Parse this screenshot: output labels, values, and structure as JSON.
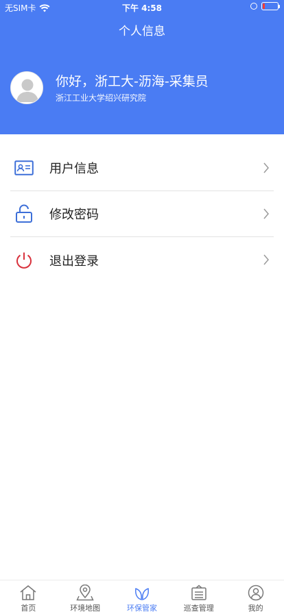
{
  "status_bar": {
    "carrier": "无SIM卡",
    "time": "下午 4:58"
  },
  "header": {
    "title": "个人信息",
    "greeting": "你好，浙工大-沥海-采集员",
    "organization": "浙江工业大学绍兴研究院",
    "color": "#4a7cf3"
  },
  "menu": {
    "items": [
      {
        "label": "用户信息",
        "icon": "id-card-icon"
      },
      {
        "label": "修改密码",
        "icon": "unlock-icon"
      },
      {
        "label": "退出登录",
        "icon": "power-icon"
      }
    ]
  },
  "tabbar": {
    "items": [
      {
        "label": "首页",
        "icon": "home-icon"
      },
      {
        "label": "环境地图",
        "icon": "map-pin-icon"
      },
      {
        "label": "环保管家",
        "icon": "leaf-icon",
        "active": true
      },
      {
        "label": "巡查管理",
        "icon": "clipboard-icon"
      },
      {
        "label": "我的",
        "icon": "user-icon"
      }
    ]
  }
}
